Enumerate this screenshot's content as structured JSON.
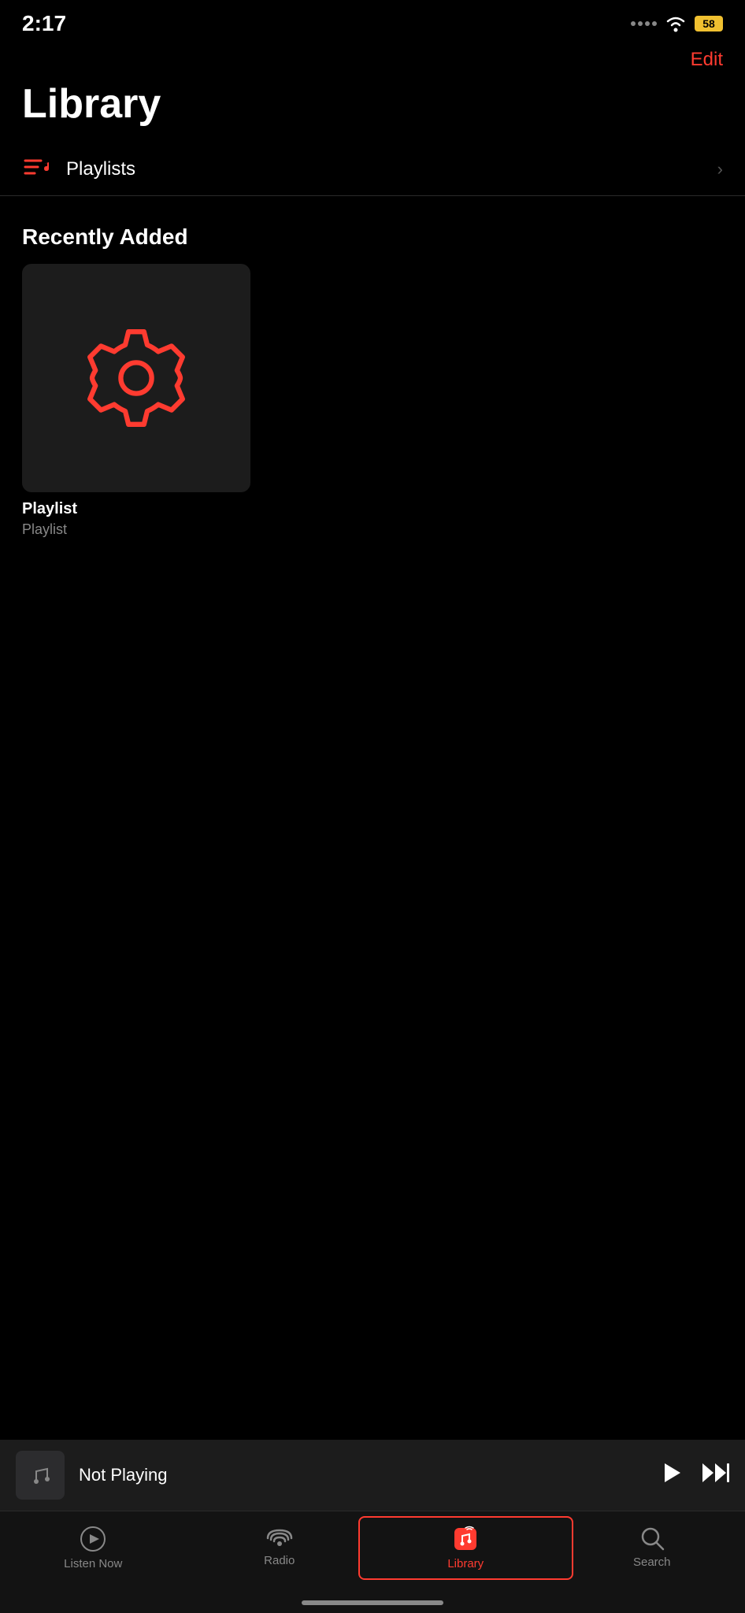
{
  "statusBar": {
    "time": "2:17",
    "battery": "58",
    "batteryColor": "#f0c030"
  },
  "header": {
    "editLabel": "Edit",
    "titleLabel": "Library"
  },
  "playlists": {
    "label": "Playlists",
    "chevron": "›"
  },
  "recentlyAdded": {
    "sectionLabel": "Recently Added",
    "items": [
      {
        "name": "Playlist",
        "subtitle": "Playlist"
      }
    ]
  },
  "miniPlayer": {
    "title": "Not Playing"
  },
  "tabBar": {
    "items": [
      {
        "id": "listen-now",
        "label": "Listen Now",
        "icon": "▶",
        "active": false
      },
      {
        "id": "radio",
        "label": "Radio",
        "icon": "radio",
        "active": false
      },
      {
        "id": "library",
        "label": "Library",
        "icon": "library",
        "active": true
      },
      {
        "id": "search",
        "label": "Search",
        "icon": "search",
        "active": false
      }
    ]
  }
}
